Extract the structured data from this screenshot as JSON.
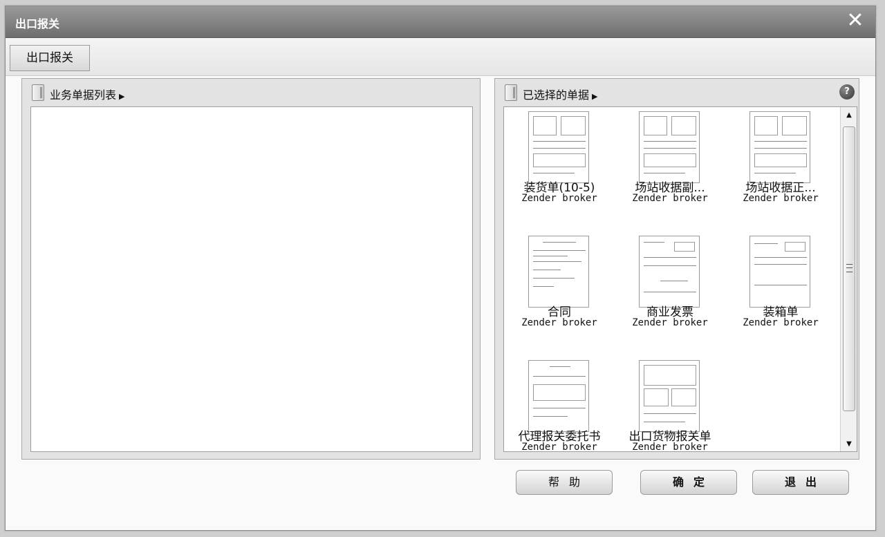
{
  "window": {
    "title": "出口报关",
    "close_icon": "close-icon"
  },
  "tabs": [
    {
      "label": "出口报关"
    }
  ],
  "left_panel": {
    "title": "业务单据列表"
  },
  "right_panel": {
    "title": "已选择的单据",
    "documents": [
      {
        "name": "装货单(10-5)",
        "owner": "Zender broker"
      },
      {
        "name": "场站收据副...",
        "owner": "Zender broker"
      },
      {
        "name": "场站收据正...",
        "owner": "Zender broker"
      },
      {
        "name": "合同",
        "owner": "Zender broker"
      },
      {
        "name": "商业发票",
        "owner": "Zender broker"
      },
      {
        "name": "装箱单",
        "owner": "Zender broker"
      },
      {
        "name": "代理报关委托书",
        "owner": "Zender broker"
      },
      {
        "name": "出口货物报关单",
        "owner": "Zender broker"
      }
    ]
  },
  "buttons": {
    "help": "帮助",
    "ok": "确定",
    "exit": "退出"
  },
  "colors": {
    "titlebar": "#7e7e7e",
    "panel_bg": "#e3e3e3"
  }
}
